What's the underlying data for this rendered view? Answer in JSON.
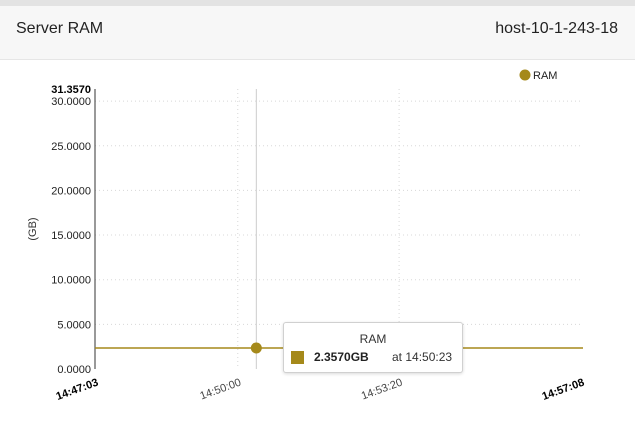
{
  "header": {
    "title": "Server RAM",
    "host": "host-10-1-243-18"
  },
  "colors": {
    "series": "#a5891a",
    "axis": "#333333",
    "grid": "#d8d8d8",
    "cursor": "#cccccc"
  },
  "tooltip": {
    "title": "RAM",
    "value": "2.3570GB",
    "time_text": "at 14:50:23"
  },
  "chart_data": {
    "type": "line",
    "title": "",
    "xlabel": "",
    "ylabel": "(GB)",
    "x_range": [
      "14:47:03",
      "14:57:08"
    ],
    "x_ticks": [
      {
        "label": "14:47:03",
        "bold": true
      },
      {
        "label": "14:50:00",
        "bold": false
      },
      {
        "label": "14:53:20",
        "bold": false
      },
      {
        "label": "14:57:08",
        "bold": true
      }
    ],
    "ylim": [
      0,
      31.357
    ],
    "y_ticks": [
      "0.0000",
      "5.0000",
      "10.0000",
      "15.0000",
      "20.0000",
      "25.0000",
      "30.0000"
    ],
    "y_max_label": "31.3570",
    "grid": true,
    "legend_position": "top-right",
    "series": [
      {
        "name": "RAM",
        "color": "#a5891a",
        "points": [
          {
            "x": "14:47:03",
            "y": 2.357
          },
          {
            "x": "14:57:08",
            "y": 2.357
          }
        ]
      }
    ],
    "highlight": {
      "x": "14:50:23",
      "y": 2.357
    }
  }
}
